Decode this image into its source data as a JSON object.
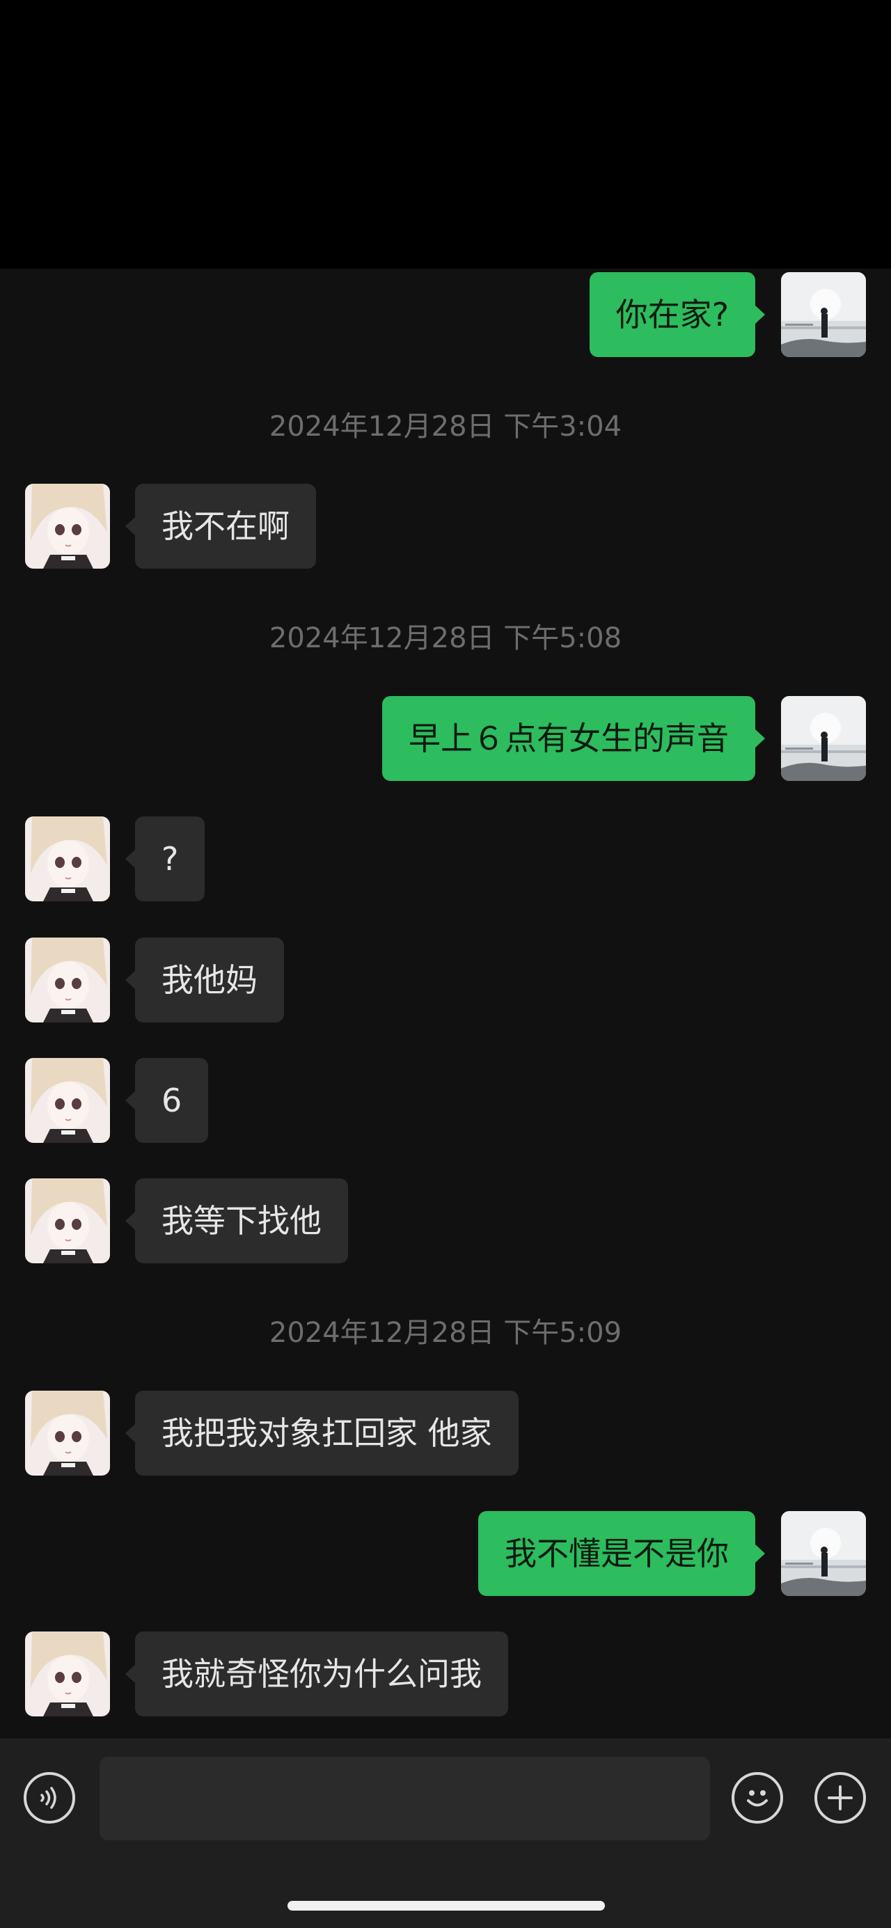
{
  "messages": [
    {
      "text": "你在家?"
    },
    {
      "text": "我不在啊"
    },
    {
      "text": "早上６点有女生的声音"
    },
    {
      "text": "?"
    },
    {
      "text": "我他妈"
    },
    {
      "text": "6"
    },
    {
      "text": "我等下找他"
    },
    {
      "text": "我把我对象扛回家 他家"
    },
    {
      "text": "我不懂是不是你"
    },
    {
      "text": "我就奇怪你为什么问我"
    }
  ],
  "timestamps": [
    "2024年12月28日 下午3:04",
    "2024年12月28日 下午5:08",
    "2024年12月28日 下午5:09"
  ],
  "input": {
    "placeholder": ""
  },
  "colors": {
    "outgoing_bubble": "#2dbc5e",
    "incoming_bubble": "#2c2c2c",
    "background": "#111111",
    "timestamp_text": "#6d6d6d"
  },
  "icons": {
    "voice": "voice-icon",
    "emoji": "emoji-icon",
    "more": "plus-icon"
  }
}
